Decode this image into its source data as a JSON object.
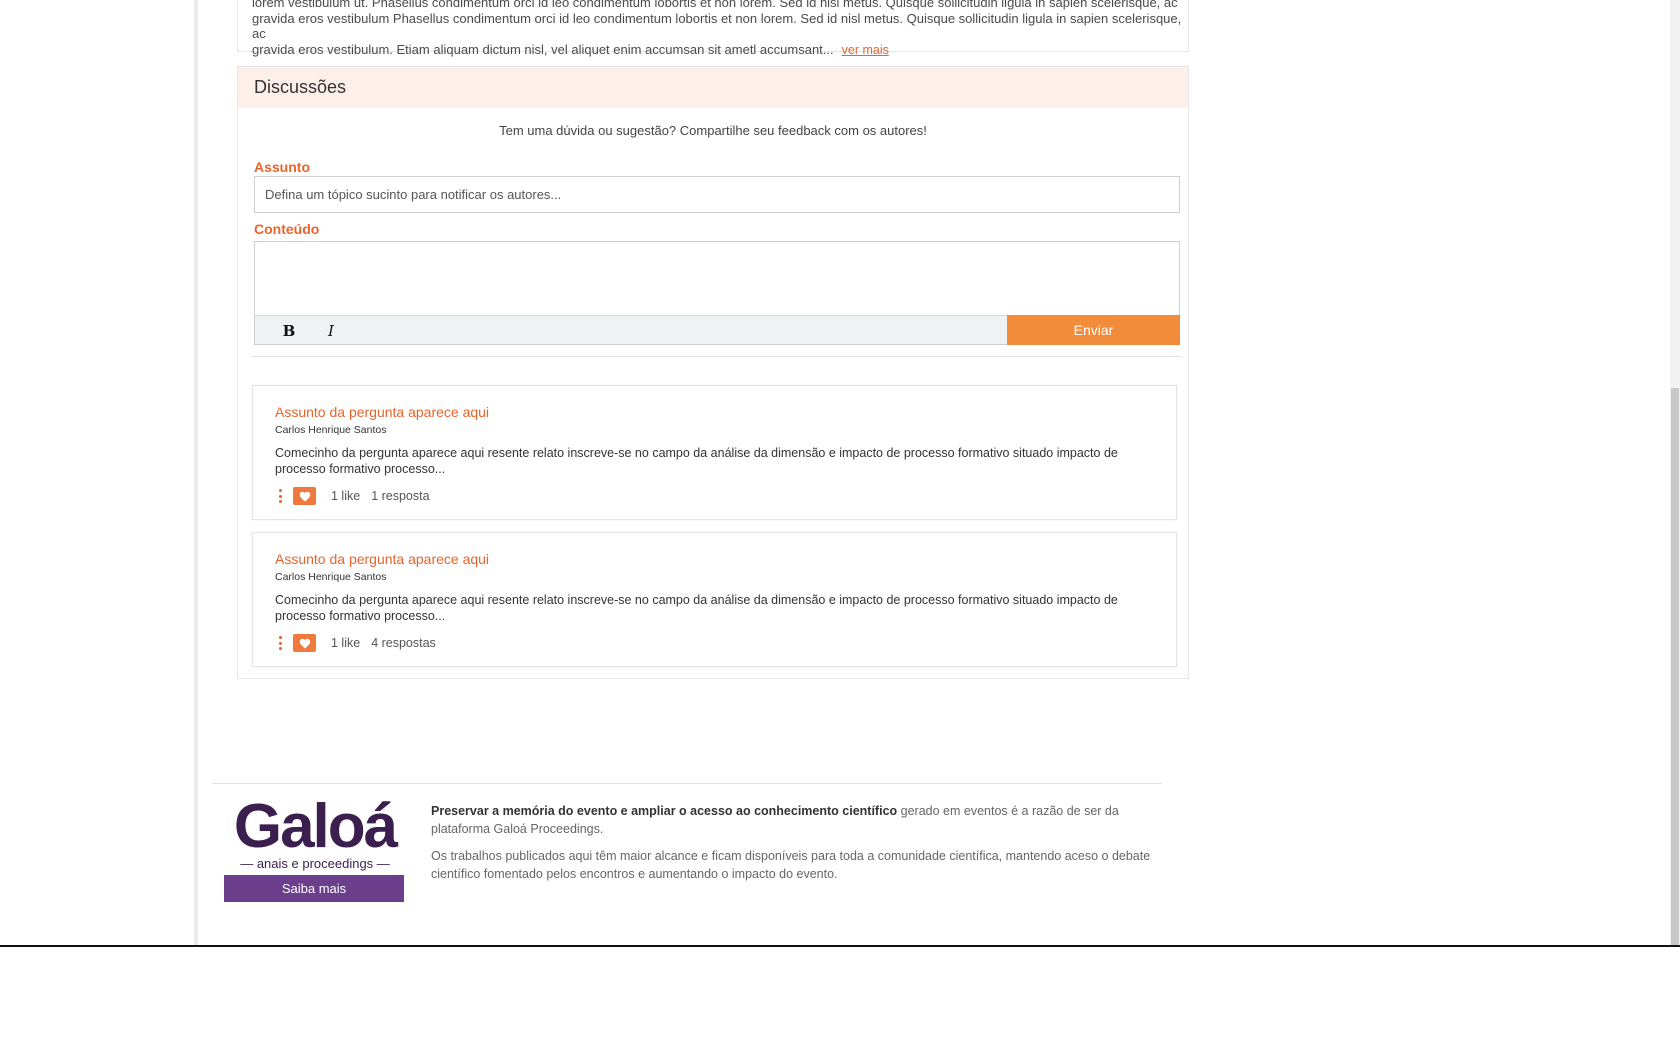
{
  "abstract": {
    "line1": "lorem vestibulum ut. Phasellus condimentum orci id leo condimentum lobortis et non lorem. Sed id nisl metus. Quisque sollicitudin ligula in sapien scelerisque, ac",
    "line2": "gravida eros vestibulum Phasellus condimentum orci id leo condimentum lobortis et non lorem. Sed id nisl metus. Quisque sollicitudin ligula in sapien scelerisque, ac",
    "line3": "gravida eros vestibulum. Etiam aliquam dictum nisl, vel aliquet enim accumsan sit ametl accumsant...",
    "more_link": "ver mais"
  },
  "discussions": {
    "title": "Discussões",
    "intro": "Tem uma dúvida ou sugestão? Compartilhe seu feedback com os autores!",
    "subject_label": "Assunto",
    "subject_placeholder": "Defina um tópico sucinto para notificar os autores...",
    "content_label": "Conteúdo",
    "bold_label": "B",
    "italic_label": "I",
    "submit_label": "Enviar",
    "questions": [
      {
        "title": "Assunto da pergunta aparece aqui",
        "author": "Carlos Henrique Santos",
        "excerpt": "Comecinho da pergunta aparece aqui resente relato inscreve-se no campo da análise da dimensão e impacto de processo formativo situado impacto de processo formativo processo...",
        "likes": "1 like",
        "replies": "1 resposta"
      },
      {
        "title": "Assunto da pergunta aparece aqui",
        "author": "Carlos Henrique Santos",
        "excerpt": "Comecinho da pergunta aparece aqui resente relato inscreve-se no campo da análise da dimensão e impacto de processo formativo situado impacto de processo formativo processo...",
        "likes": "1 like",
        "replies": "4 respostas"
      }
    ]
  },
  "footer": {
    "logo_text": "Galoá",
    "logo_tagline": "— anais e proceedings —",
    "cta_label": "Saiba mais",
    "para1_bold": "Preservar a memória do evento e ampliar o acesso ao conhecimento científico",
    "para1_rest": " gerado em eventos é a razão de ser da plataforma Galoá Proceedings.",
    "para2": "Os trabalhos publicados aqui têm maior alcance e ficam disponíveis para toda a comunidade científica, mantendo aceso o debate científico fomentado pelos encontros e aumentando o impacto do evento."
  },
  "colors": {
    "accent": "#e8642c",
    "button": "#f28b3a",
    "brand_purple": "#6b3f8c"
  }
}
